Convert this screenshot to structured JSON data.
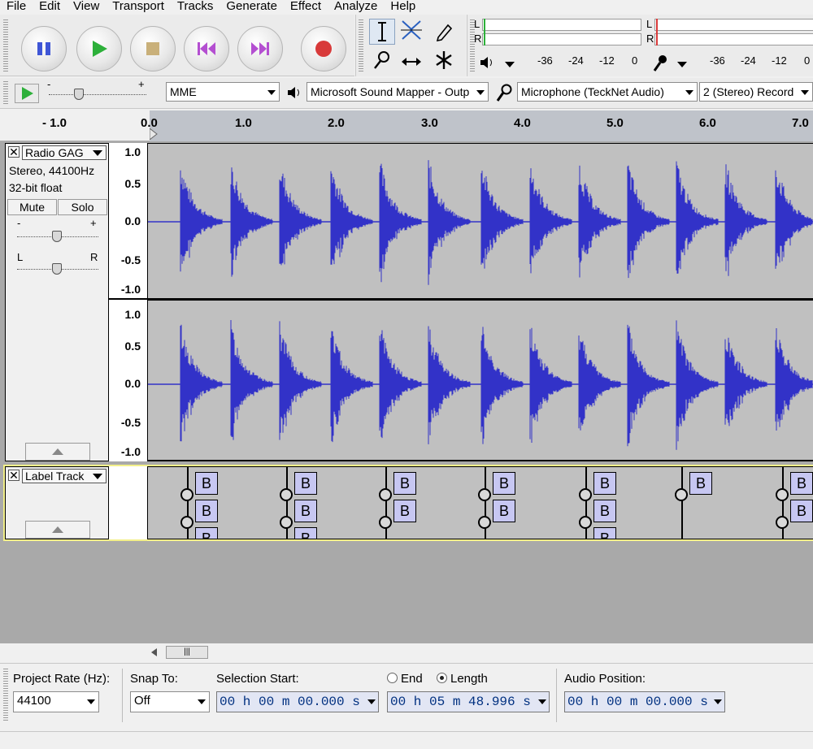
{
  "menu": [
    "File",
    "Edit",
    "View",
    "Transport",
    "Tracks",
    "Generate",
    "Effect",
    "Analyze",
    "Help"
  ],
  "transport": {
    "buttons": [
      "pause",
      "play",
      "stop",
      "skip-to-start",
      "skip-to-end",
      "record"
    ],
    "colors": {
      "pause": "#3f56d6",
      "play": "#2db03a",
      "stop": "#c9b07a",
      "skip": "#b44fd1",
      "record": "#d83a3a"
    }
  },
  "tools": [
    "selection-tool",
    "envelope-tool",
    "draw-tool",
    "zoom-tool",
    "time-shift-tool",
    "multi-tool"
  ],
  "meters": {
    "playback": {
      "channels": [
        "L",
        "R"
      ],
      "scale": [
        "-36",
        "-24",
        "-12",
        "0"
      ]
    },
    "recording": {
      "channels": [
        "L",
        "R"
      ],
      "scale": [
        "-36",
        "-24",
        "-12",
        "0"
      ]
    }
  },
  "device": {
    "host": "MME",
    "output": "Microsoft Sound Mapper - Outp",
    "input": "Microphone (TeckNet Audio)",
    "channels": "2 (Stereo) Record",
    "speed_minus": "-",
    "speed_plus": "+"
  },
  "ruler": {
    "labels": [
      "- 1.0",
      "0.0",
      "1.0",
      "2.0",
      "3.0",
      "4.0",
      "5.0",
      "6.0",
      "7.0"
    ]
  },
  "audio_track": {
    "name": "Radio GAG",
    "info1": "Stereo, 44100Hz",
    "info2": "32-bit float",
    "mute": "Mute",
    "solo": "Solo",
    "gain_minus": "-",
    "gain_plus": "+",
    "pan_left": "L",
    "pan_right": "R",
    "vscale": [
      "1.0",
      "0.5",
      "0.0",
      "-0.5",
      "-1.0"
    ],
    "wave_color": "#3232c8"
  },
  "label_track": {
    "name": "Label Track",
    "label_text": "B"
  },
  "selection": {
    "project_rate_label": "Project Rate (Hz):",
    "project_rate": "44100",
    "snap_label": "Snap To:",
    "snap_value": "Off",
    "sel_start_label": "Selection Start:",
    "end_label": "End",
    "length_label": "Length",
    "audio_pos_label": "Audio Position:",
    "sel_start": "00 h 00 m 00.000 s",
    "length": "00 h 05 m 48.996 s",
    "audio_pos": "00 h 00 m 00.000 s"
  }
}
